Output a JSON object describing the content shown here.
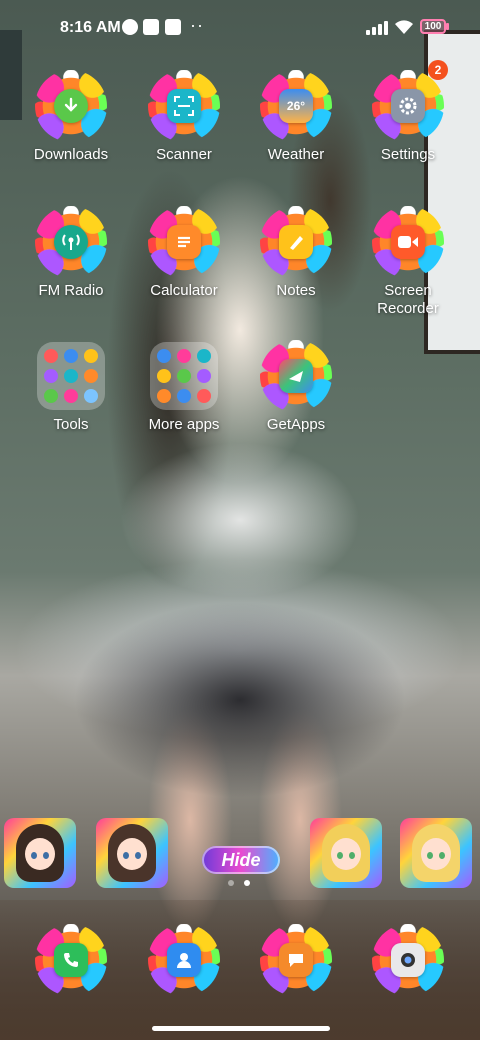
{
  "status_bar": {
    "time": "8:16 AM",
    "battery": "100",
    "dots": "··"
  },
  "apps": [
    {
      "label": "Downloads",
      "icon": "download-icon",
      "color": "#5ac84a"
    },
    {
      "label": "Scanner",
      "icon": "scanner-icon",
      "color": "#1bb6c9"
    },
    {
      "label": "Weather",
      "icon": "weather-icon",
      "color": "#3c8df0",
      "icon_text": "26°"
    },
    {
      "label": "Settings",
      "icon": "gear-icon",
      "color": "#8a96a8",
      "badge": "2"
    },
    {
      "label": "FM Radio",
      "icon": "radio-icon",
      "color": "#18a88c"
    },
    {
      "label": "Calculator",
      "icon": "calculator-icon",
      "color": "#ff8a2a"
    },
    {
      "label": "Notes",
      "icon": "notes-icon",
      "color": "#ffc21a"
    },
    {
      "label": "Screen\nRecorder",
      "icon": "video-icon",
      "color": "#ff5a2a"
    },
    {
      "label": "Tools",
      "icon": "folder-icon"
    },
    {
      "label": "More apps",
      "icon": "folder-icon"
    },
    {
      "label": "GetApps",
      "icon": "getapps-icon",
      "color": "#ff4b6b"
    }
  ],
  "widget": {
    "hide_label": "Hide"
  },
  "dock": [
    {
      "icon": "phone-icon",
      "color": "#2dbe5a"
    },
    {
      "icon": "contacts-icon",
      "color": "#2f8cf0"
    },
    {
      "icon": "messages-icon",
      "color": "#f58a2a"
    },
    {
      "icon": "camera-icon",
      "color": "#e8e8ea"
    }
  ]
}
